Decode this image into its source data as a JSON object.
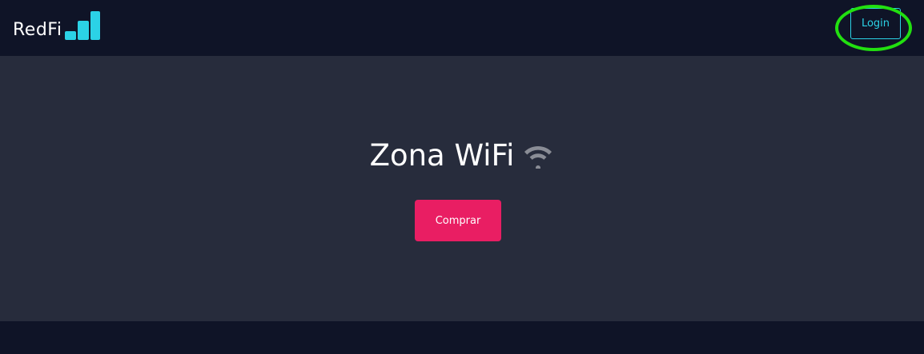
{
  "brand": {
    "name": "RedFi",
    "bar_color": "#2bd2e6"
  },
  "nav": {
    "login_label": "Login",
    "login_border": "#2bd2e6",
    "login_text": "#2bd2e6",
    "highlight_color": "#22e010"
  },
  "hero": {
    "title": "Zona WiFi",
    "icon": "wifi-icon",
    "buy_label": "Comprar",
    "buy_color": "#e91e63"
  }
}
